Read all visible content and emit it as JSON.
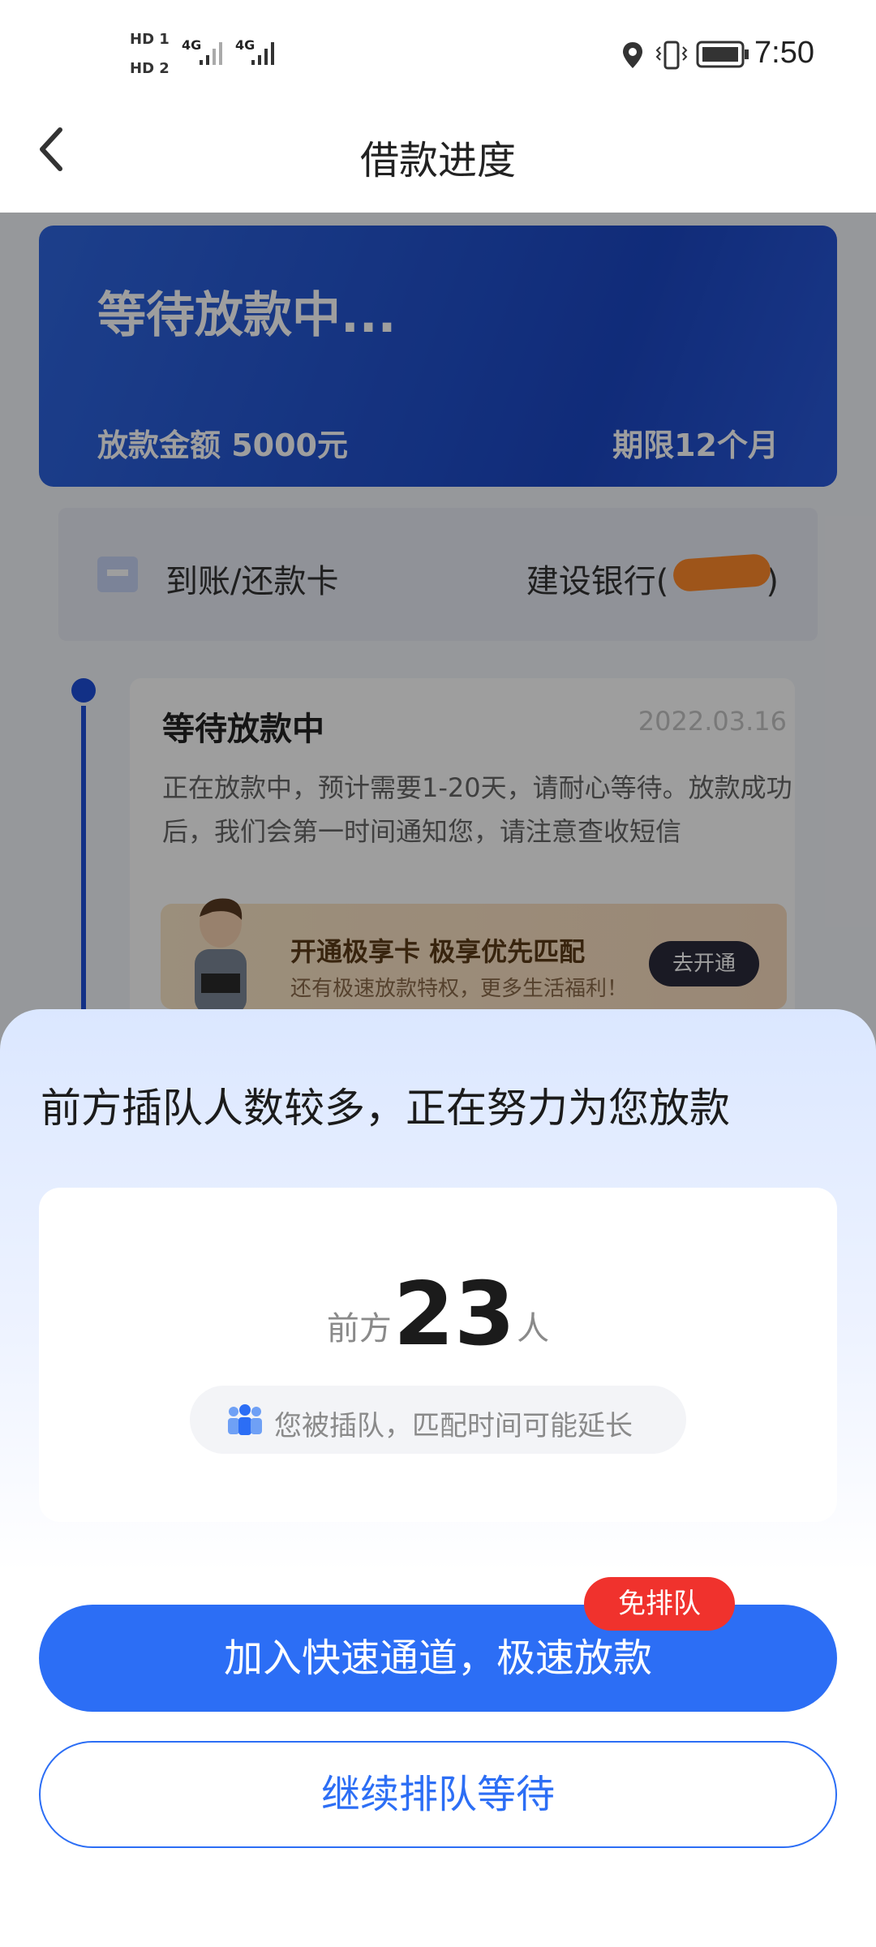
{
  "status_bar": {
    "hd1": "HD",
    "hd1_sim": "1",
    "hd2": "HD",
    "hd2_sim": "2",
    "network1": "4G",
    "network2": "4G",
    "time": "7:50"
  },
  "header": {
    "title": "借款进度"
  },
  "loan_card": {
    "status": "等待放款中...",
    "amount": "放款金额 5000元",
    "term": "期限12个月"
  },
  "bank_row": {
    "label": "到账/还款卡",
    "bank": "建设银行(",
    "bank_suffix": ")"
  },
  "progress_step": {
    "title": "等待放款中",
    "date": "2022.03.16",
    "description": "正在放款中，预计需要1-20天，请耐心等待。放款成功后，我们会第一时间通知您，请注意查收短信"
  },
  "promo": {
    "title": "开通极享卡 极享优先匹配",
    "subtitle": "还有极速放款特权，更多生活福利！",
    "button": "去开通"
  },
  "sheet": {
    "title": "前方插队人数较多，正在努力为您放款",
    "queue_prefix": "前方",
    "queue_count": "23",
    "queue_suffix": "人",
    "notice": "您被插队，匹配时间可能延长",
    "fast_button": "加入快速通道，极速放款",
    "fast_badge": "免排队",
    "wait_button": "继续排队等待"
  },
  "colors": {
    "primary": "#2c6ef5",
    "badge": "#f0322d",
    "card_blue": "#1b47c4"
  }
}
